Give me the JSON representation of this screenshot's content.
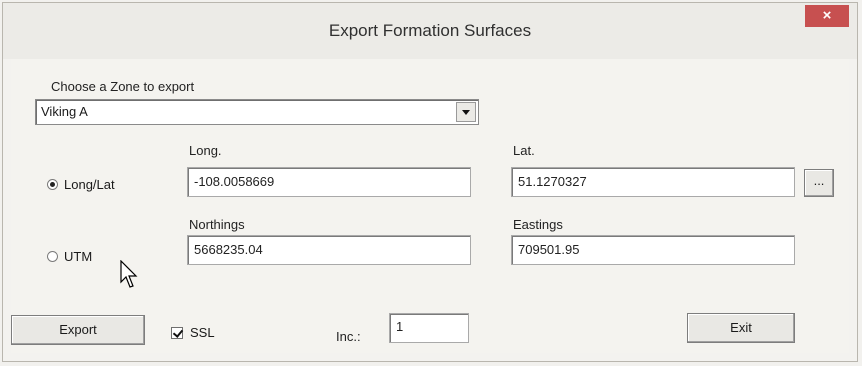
{
  "window": {
    "title": "Export Formation Surfaces",
    "close_glyph": "×"
  },
  "zone": {
    "label": "Choose a Zone to export",
    "selected": "Viking A"
  },
  "coords": {
    "long_lat_option": "Long/Lat",
    "utm_option": "UTM",
    "selected_option": "Long/Lat",
    "long_label": "Long.",
    "long_value": "-108.0058669",
    "lat_label": "Lat.",
    "lat_value": "51.1270327",
    "browse_label": "...",
    "northings_label": "Northings",
    "northings_value": "5668235.04",
    "eastings_label": "Eastings",
    "eastings_value": "709501.95"
  },
  "actions": {
    "export_label": "Export",
    "ssl_label": "SSL",
    "ssl_checked": true,
    "inc_label": "Inc.:",
    "inc_value": "1",
    "exit_label": "Exit"
  }
}
